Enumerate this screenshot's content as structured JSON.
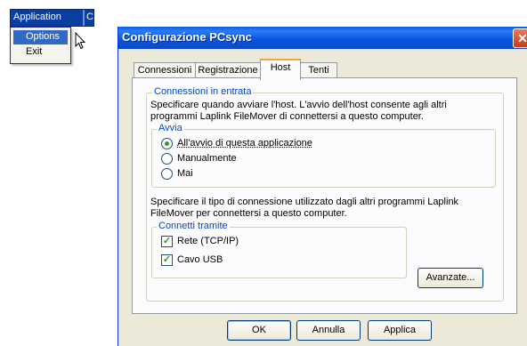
{
  "menubar": {
    "app_label": "Application",
    "truncated_label": "Co"
  },
  "popup_menu": {
    "items": [
      {
        "label": "Options"
      },
      {
        "label": "Exit"
      }
    ]
  },
  "dialog": {
    "title": "Configurazione PCsync",
    "close_glyph": "✕",
    "tabs": [
      {
        "label": "Connessioni"
      },
      {
        "label": "Registrazione"
      },
      {
        "label": "Host",
        "selected": true
      },
      {
        "label": "Tenti"
      }
    ],
    "inbound_group": {
      "label": "Connessioni in entrata",
      "description_line1": "Specificare quando avviare l'host. L'avvio dell'host consente agli altri",
      "description_line2": "programmi Laplink FileMover di connettersi a questo computer.",
      "start_group": {
        "label": "Avvia",
        "options": [
          {
            "label": "All'avvio di questa applicazione",
            "checked": true
          },
          {
            "label": "Manualmente",
            "checked": false
          },
          {
            "label": "Mai",
            "checked": false
          }
        ]
      },
      "connection_description_line1": "Specificare il tipo di connessione utilizzato dagli altri programmi Laplink",
      "connection_description_line2": "FileMover per connettersi a questo computer.",
      "connect_via_group": {
        "label": "Connetti tramite",
        "options": [
          {
            "label": "Rete (TCP/IP)",
            "checked": true
          },
          {
            "label": "Cavo USB",
            "checked": true
          }
        ]
      },
      "advanced_button": "Avanzate..."
    },
    "buttons": {
      "ok": "OK",
      "cancel": "Annulla",
      "apply": "Applica"
    },
    "check_glyph": "✓"
  }
}
